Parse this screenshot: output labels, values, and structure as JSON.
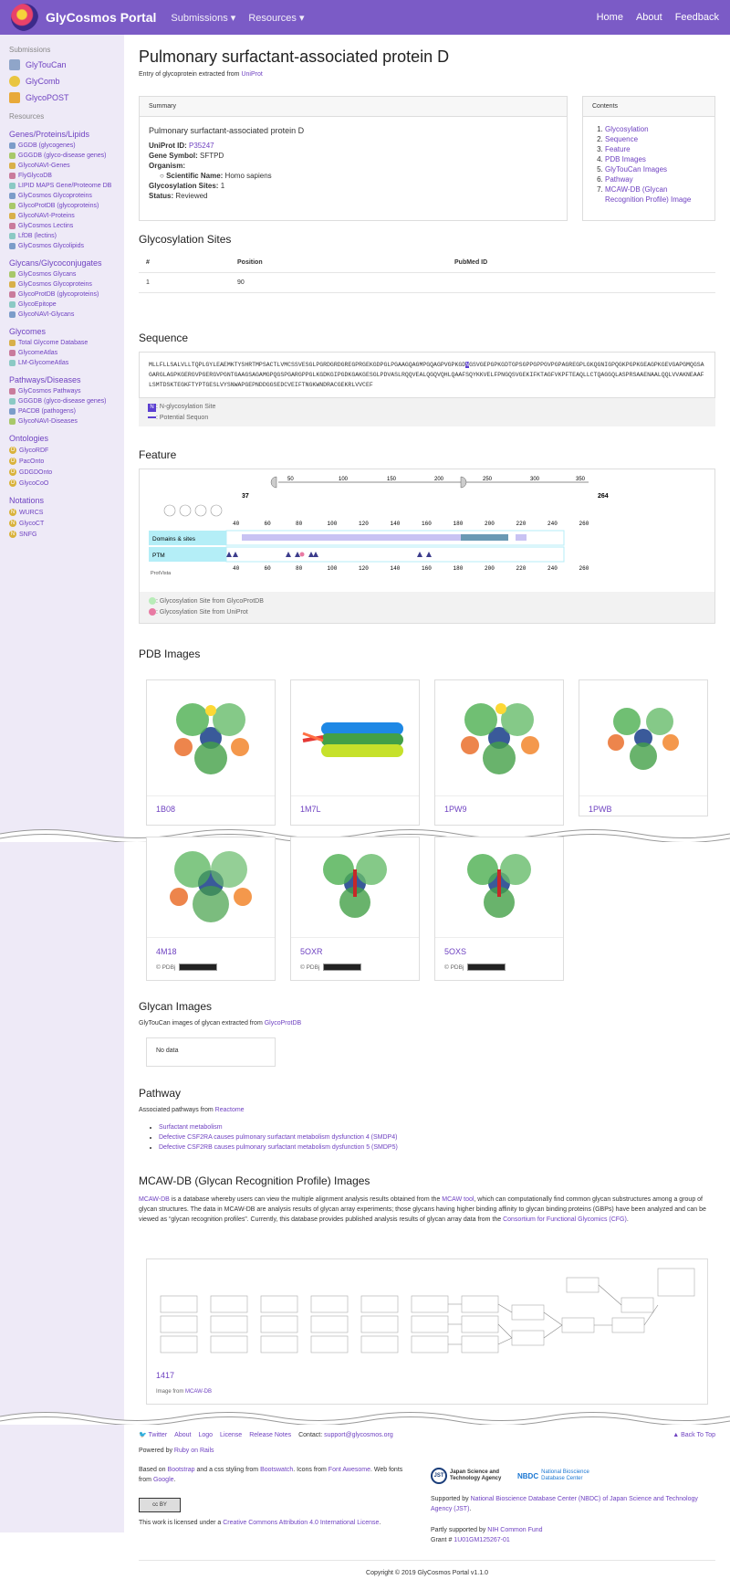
{
  "nav": {
    "brand": "GlyCosmos Portal",
    "submissions": "Submissions",
    "resources": "Resources",
    "home": "Home",
    "about": "About",
    "feedback": "Feedback"
  },
  "sidebar": {
    "submissions_head": "Submissions",
    "submissions": [
      "GlyTouCan",
      "GlyComb",
      "GlycoPOST"
    ],
    "resources_head": "Resources",
    "sections": [
      {
        "title": "Genes/Proteins/Lipids",
        "items": [
          "GGDB (glycogenes)",
          "GGGDB (glyco-disease genes)",
          "GlycoNAVI-Genes",
          "FlyGlycoDB",
          "LIPID MAPS Gene/Proteome DB",
          "GlyCosmos Glycoproteins",
          "GlycoProtDB (glycoproteins)",
          "GlycoNAVI-Proteins",
          "GlyCosmos Lectins",
          "LfDB (lectins)",
          "GlyCosmos Glycolipids"
        ]
      },
      {
        "title": "Glycans/Glycoconjugates",
        "items": [
          "GlyCosmos Glycans",
          "GlyCosmos Glycoproteins",
          "GlycoProtDB (glycoproteins)",
          "GlycoEpitope",
          "GlycoNAVI-Glycans"
        ]
      },
      {
        "title": "Glycomes",
        "items": [
          "Total Glycome Database",
          "GlycomeAtlas",
          "LM-GlycomeAtlas"
        ]
      },
      {
        "title": "Pathways/Diseases",
        "items": [
          "GlyCosmos Pathways",
          "GGGDB (glyco-disease genes)",
          "PACDB (pathogens)",
          "GlycoNAVI-Diseases"
        ]
      },
      {
        "title": "Ontologies",
        "items": [
          "GlycoRDF",
          "PacOnto",
          "GDGDOnto",
          "GlycoCoO"
        ]
      },
      {
        "title": "Notations",
        "items": [
          "WURCS",
          "GlycoCT",
          "SNFG"
        ]
      }
    ]
  },
  "page": {
    "title": "Pulmonary surfactant-associated protein D",
    "subtitle_prefix": "Entry of glycoprotein extracted from ",
    "subtitle_link": "UniProt"
  },
  "summary": {
    "header": "Summary",
    "name": "Pulmonary surfactant-associated protein D",
    "uniprot_label": "UniProt ID:",
    "uniprot_value": "P35247",
    "gene_label": "Gene Symbol:",
    "gene_value": "SFTPD",
    "organism_label": "Organism:",
    "sci_label": "Scientific Name:",
    "sci_value": "Homo sapiens",
    "sites_label": "Glycosylation Sites:",
    "sites_value": "1",
    "status_label": "Status:",
    "status_value": "Reviewed"
  },
  "contents": {
    "header": "Contents",
    "items": [
      "Glycosylation",
      "Sequence",
      "Feature",
      "PDB Images",
      "GlyTouCan Images",
      "Pathway",
      "MCAW-DB (Glycan Recognition Profile) Image"
    ]
  },
  "glyco_sites": {
    "title": "Glycosylation Sites",
    "headers": [
      "#",
      "Position",
      "PubMed ID"
    ],
    "rows": [
      [
        "1",
        "90",
        ""
      ]
    ]
  },
  "sequence": {
    "title": "Sequence",
    "before": "MLLFLLSALVLLTQPLGYLEAEMKTYSHRTMPSACTLVMCSSVESGLPGRDGRDGREGPRGEKGDPGLPGAAGQAGMPGQAGPVGPKGD",
    "site": "N",
    "after": "GSVGEPGPKGDTGPSGPPGPPGVPGPAGREGPLGKQGNIGPQGKPGPKGEAGPKGEVGAPGMQGSAGARGLAGPKGERGVPGERGVPGNTGAAGSAGAMGPQGSPGARGPPGLKGDKGIPGDKGAKGESGLPDVASLRQQVEALQGQVQHLQAAFSQYKKVELFPNGQSVGEKIFKTAGFVKPFTEAQLLCTQAGGQLASPRSAAENAALQQLVVAKNEAAFLSMTDSKTEGKFTYPTGESLVYSNWAPGEPNDDGGSEDCVEIFTNGKWNDRACGEKRLVVCEF",
    "legend_site": ": N-glycosylation Site",
    "legend_sequon": ": Potential Sequon"
  },
  "feature": {
    "title": "Feature",
    "range_start": "37",
    "range_end": "264",
    "top_ticks": [
      "50",
      "100",
      "150",
      "200",
      "250",
      "300",
      "350"
    ],
    "ticks": [
      "40",
      "60",
      "80",
      "100",
      "120",
      "140",
      "160",
      "180",
      "200",
      "220",
      "240",
      "260"
    ],
    "track1": "Domains & sites",
    "track2": "PTM",
    "protvista": "ProtVista",
    "legend1": ": Glycosylation Site from GlycoProtDB",
    "legend2": ": Glycosylation Site from UniProt"
  },
  "pdb": {
    "title": "PDB Images",
    "credit": "© PDBj",
    "entries": [
      "1B08",
      "1M7L",
      "1PW9",
      "1PWB",
      "4M18",
      "5OXR",
      "5OXS"
    ]
  },
  "glycan_images": {
    "title": "Glycan Images",
    "desc_prefix": "GlyTouCan images of glycan extracted from ",
    "desc_link": "GlycoProtDB",
    "empty": "No data"
  },
  "pathway": {
    "title": "Pathway",
    "desc_prefix": "Associated pathways from ",
    "desc_link": "Reactome",
    "items": [
      "Surfactant metabolism",
      "Defective CSF2RA causes pulmonary surfactant metabolism dysfunction 4 (SMDP4)",
      "Defective CSF2RB causes pulmonary surfactant metabolism dysfunction 5 (SMDP5)"
    ]
  },
  "mcaw": {
    "title": "MCAW-DB (Glycan Recognition Profile) Images",
    "link1": "MCAW-DB",
    "text1": " is a database whereby users can view the multiple alignment analysis results obtained from the ",
    "link2": "MCAW tool",
    "text2": ", which can computationally find common glycan substructures among a group of glycan structures. The data in MCAW-DB are analysis results of glycan array experiments; those glycans having higher binding affinity to glycan binding proteins (GBPs) have been analyzed and can be viewed as “glycan recognition profiles”. Currently, this database provides published analysis results of glycan array data from the ",
    "link3": "Consortium for Functional Glycomics (CFG)",
    "text3": ".",
    "id": "1417",
    "credit_prefix": "Image from ",
    "credit_link": "MCAW-DB"
  },
  "footer": {
    "links": [
      "Twitter",
      "About",
      "Logo",
      "License",
      "Release Notes"
    ],
    "contact_prefix": "Contact: ",
    "contact_email": "support@glycosmos.org",
    "back_to_top": "Back To Top",
    "powered_prefix": "Powered by ",
    "powered_link": "Ruby on Rails",
    "based1": "Based on ",
    "based_link1": "Bootstrap",
    "based2": " and a css styling from ",
    "based_link2": "Bootswatch",
    "based3": ". Icons from ",
    "based_link3": "Font Awesome",
    "based4": ". Web fonts from ",
    "based_link4": "Google",
    "based5": ".",
    "license_prefix": "This work is licensed under a ",
    "license_link": "Creative Commons Attribution 4.0 International License",
    "license_suffix": ".",
    "jst": "Japan Science and Technology Agency",
    "nbdc": "National Bioscience Database Center",
    "supported_prefix": "Supported by ",
    "supported_link": "National Bioscience Database Center (NBDC) of Japan Science and Technology Agency (JST)",
    "supported_suffix": ".",
    "partly_prefix": "Partly supported by ",
    "partly_link": "NIH Common Fund",
    "grant_prefix": "Grant # ",
    "grant_link": "1U01GM125267-01",
    "copyright": "Copyright © 2019   GlyCosmos Portal v1.1.0"
  }
}
